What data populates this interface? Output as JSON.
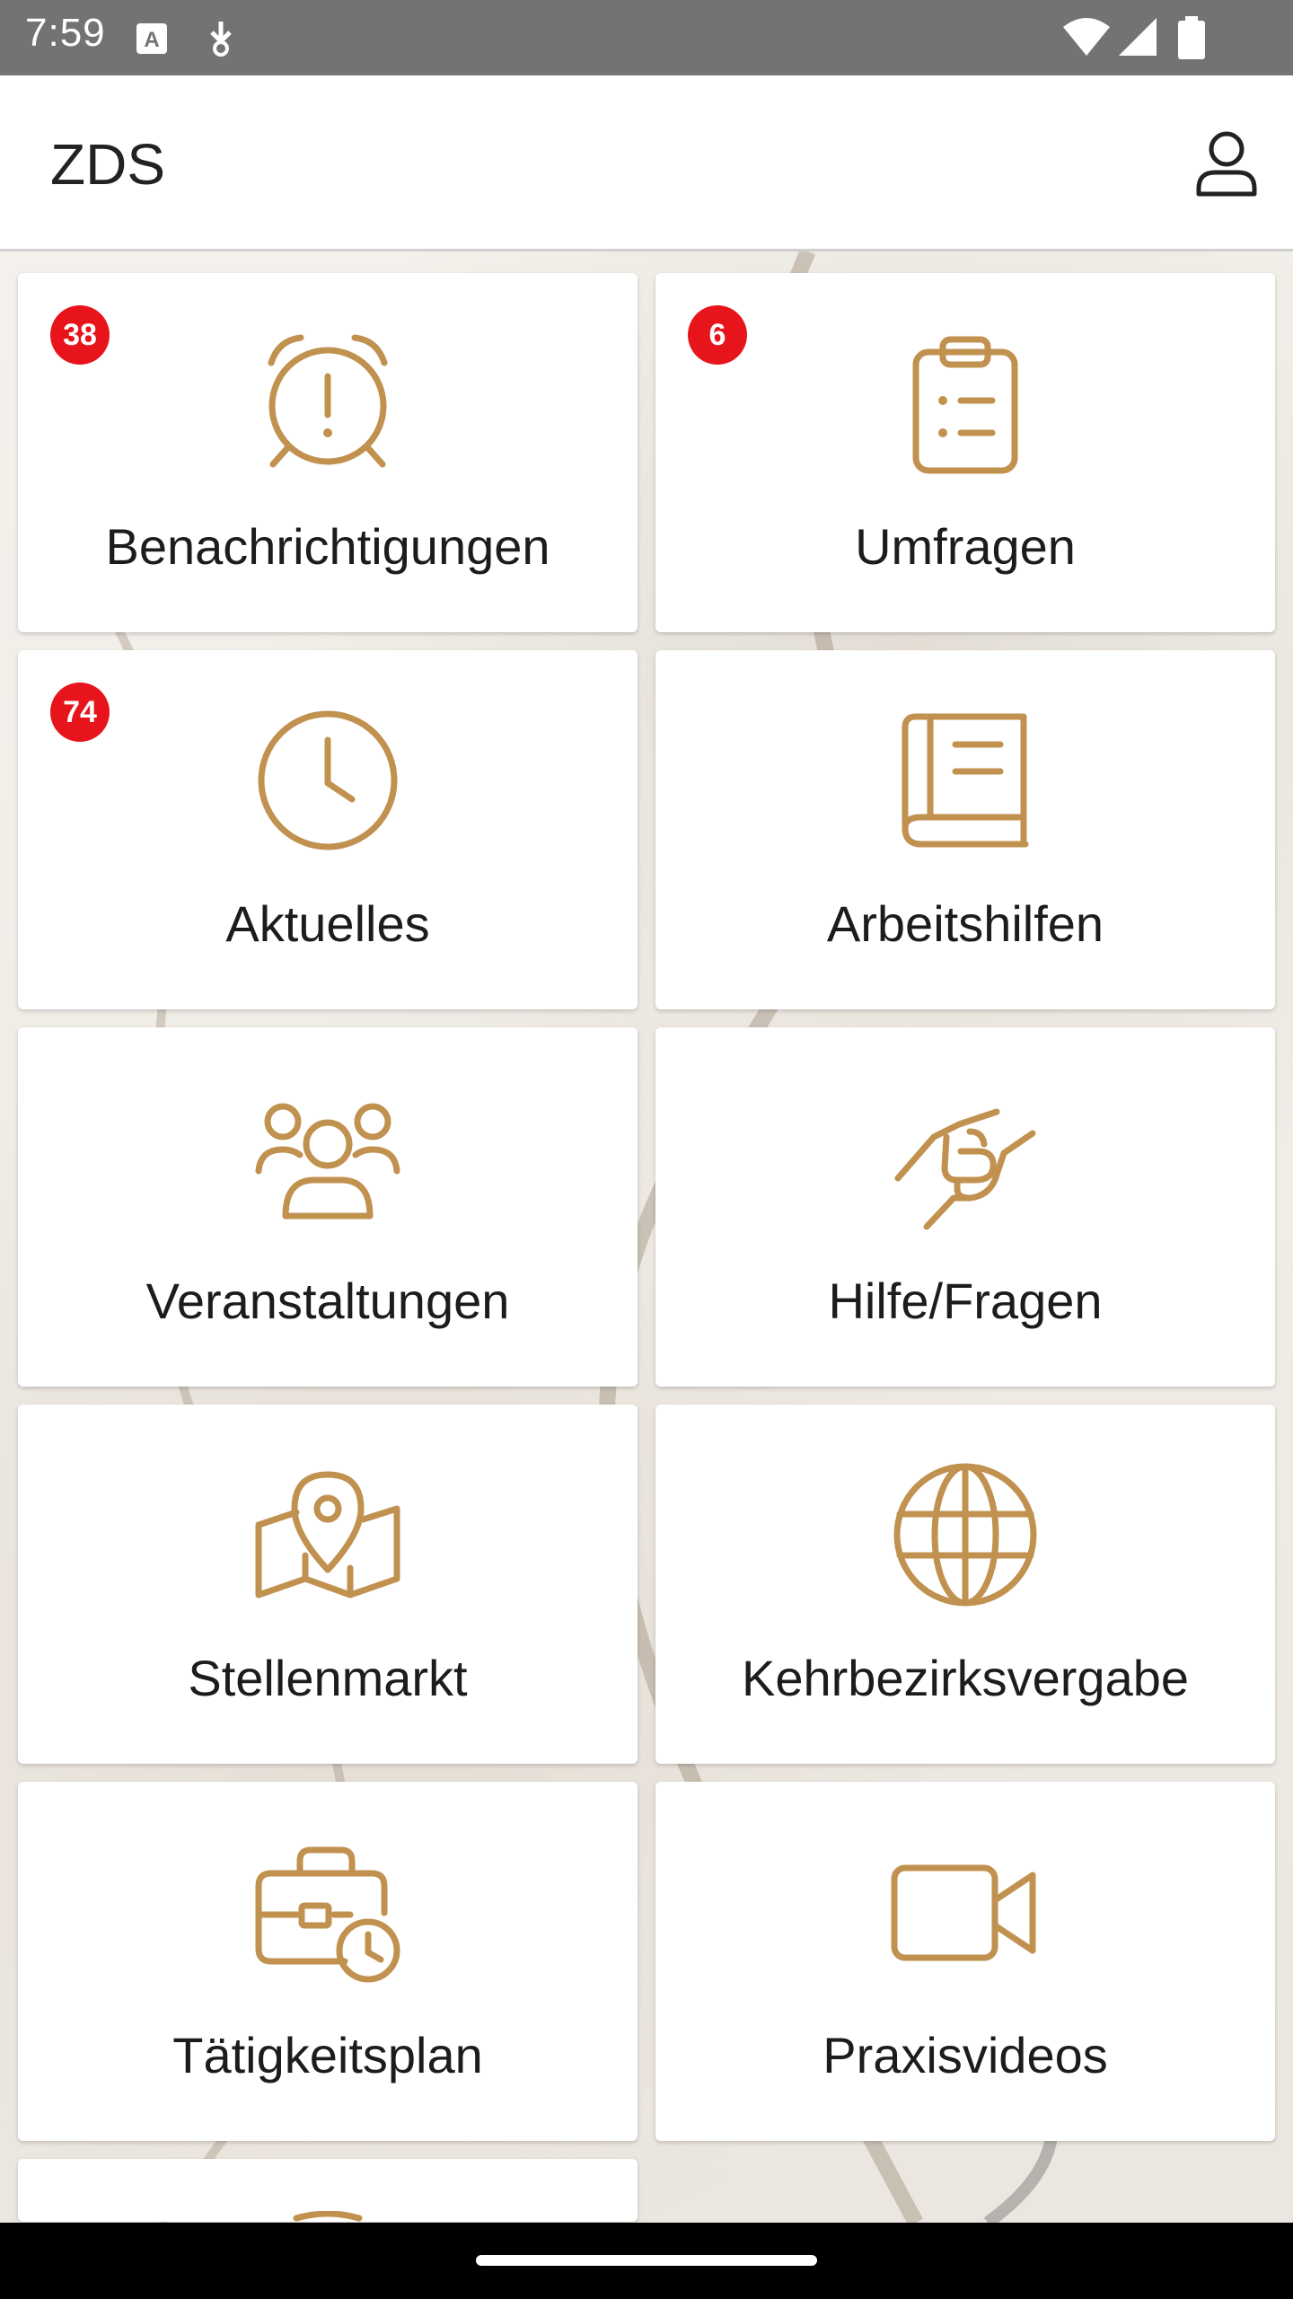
{
  "status_bar": {
    "time": "7:59",
    "icons": [
      "a-notification-icon",
      "download-icon",
      "wifi-icon",
      "signal-icon",
      "battery-icon"
    ]
  },
  "app_bar": {
    "title": "ZDS",
    "account_icon": "account-icon"
  },
  "colors": {
    "accent": "#c0914f",
    "badge": "#e8141c",
    "status_bar": "#737373"
  },
  "tiles": [
    {
      "label": "Benachrichtigungen",
      "icon": "alarm-alert-icon",
      "badge": "38"
    },
    {
      "label": "Umfragen",
      "icon": "clipboard-list-icon",
      "badge": "6"
    },
    {
      "label": "Aktuelles",
      "icon": "clock-icon",
      "badge": "74"
    },
    {
      "label": "Arbeitshilfen",
      "icon": "book-icon"
    },
    {
      "label": "Veranstaltungen",
      "icon": "users-group-icon"
    },
    {
      "label": "Hilfe/Fragen",
      "icon": "helping-hand-icon"
    },
    {
      "label": "Stellenmarkt",
      "icon": "map-pin-icon"
    },
    {
      "label": "Kehrbezirksvergabe",
      "icon": "globe-icon"
    },
    {
      "label": "Tätigkeitsplan",
      "icon": "briefcase-clock-icon"
    },
    {
      "label": "Praxisvideos",
      "icon": "video-camera-icon"
    }
  ]
}
